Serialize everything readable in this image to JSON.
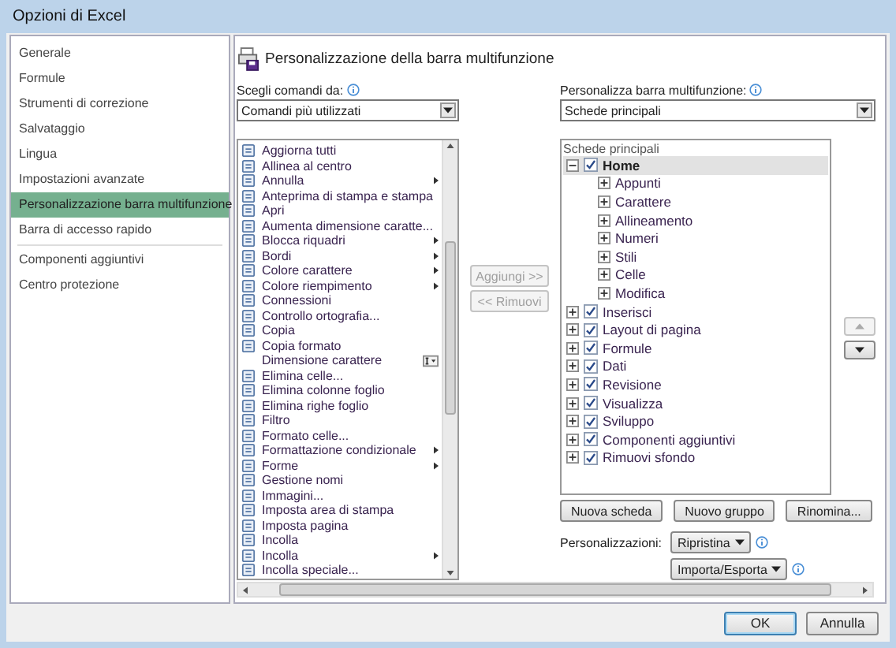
{
  "window": {
    "title": "Opzioni di Excel"
  },
  "sidebar": {
    "groups": [
      {
        "items": [
          {
            "label": "Generale",
            "selected": false
          },
          {
            "label": "Formule",
            "selected": false
          },
          {
            "label": "Strumenti di correzione",
            "selected": false
          },
          {
            "label": "Salvataggio",
            "selected": false
          },
          {
            "label": "Lingua",
            "selected": false
          },
          {
            "label": "Impostazioni avanzate",
            "selected": false
          },
          {
            "label": "Personalizzazione barra multifunzione",
            "selected": true
          },
          {
            "label": "Barra di accesso rapido",
            "selected": false
          }
        ]
      },
      {
        "items": [
          {
            "label": "Componenti aggiuntivi",
            "selected": false
          },
          {
            "label": "Centro protezione",
            "selected": false
          }
        ]
      }
    ]
  },
  "page": {
    "title": "Personalizzazione della barra multifunzione"
  },
  "commands": {
    "label": "Scegli comandi da:",
    "dropdown": "Comandi più utilizzati",
    "items": [
      {
        "label": "Aggiorna tutti",
        "kind": "plain"
      },
      {
        "label": "Allinea al centro",
        "kind": "plain"
      },
      {
        "label": "Annulla",
        "kind": "submenu"
      },
      {
        "label": "Anteprima di stampa e stampa",
        "kind": "plain"
      },
      {
        "label": "Apri",
        "kind": "plain"
      },
      {
        "label": "Aumenta dimensione caratte...",
        "kind": "plain"
      },
      {
        "label": "Blocca riquadri",
        "kind": "submenu"
      },
      {
        "label": "Bordi",
        "kind": "submenu"
      },
      {
        "label": "Colore carattere",
        "kind": "submenu"
      },
      {
        "label": "Colore riempimento",
        "kind": "submenu"
      },
      {
        "label": "Connessioni",
        "kind": "plain"
      },
      {
        "label": "Controllo ortografia...",
        "kind": "plain"
      },
      {
        "label": "Copia",
        "kind": "plain"
      },
      {
        "label": "Copia formato",
        "kind": "plain"
      },
      {
        "label": "Dimensione carattere",
        "kind": "combo"
      },
      {
        "label": "Elimina celle...",
        "kind": "plain"
      },
      {
        "label": "Elimina colonne foglio",
        "kind": "plain"
      },
      {
        "label": "Elimina righe foglio",
        "kind": "plain"
      },
      {
        "label": "Filtro",
        "kind": "plain"
      },
      {
        "label": "Formato celle...",
        "kind": "plain"
      },
      {
        "label": "Formattazione condizionale",
        "kind": "submenu"
      },
      {
        "label": "Forme",
        "kind": "submenu"
      },
      {
        "label": "Gestione nomi",
        "kind": "plain"
      },
      {
        "label": "Immagini...",
        "kind": "plain"
      },
      {
        "label": "Imposta area di stampa",
        "kind": "plain"
      },
      {
        "label": "Imposta pagina",
        "kind": "plain"
      },
      {
        "label": "Incolla",
        "kind": "plain"
      },
      {
        "label": "Incolla",
        "kind": "submenu"
      },
      {
        "label": "Incolla speciale...",
        "kind": "plain"
      }
    ]
  },
  "transfer_buttons": [
    {
      "label": "Aggiungi >>",
      "disabled": true
    },
    {
      "label": "<< Rimuovi",
      "disabled": true
    }
  ],
  "ribbon": {
    "label": "Personalizza barra multifunzione:",
    "dropdown": "Schede principali",
    "tree_header": "Schede principali",
    "tabs": [
      {
        "label": "Home",
        "checked": true,
        "expanded": true,
        "selected": true,
        "children": [
          {
            "label": "Appunti",
            "expanded": false
          },
          {
            "label": "Carattere",
            "expanded": false
          },
          {
            "label": "Allineamento",
            "expanded": false
          },
          {
            "label": "Numeri",
            "expanded": false
          },
          {
            "label": "Stili",
            "expanded": false
          },
          {
            "label": "Celle",
            "expanded": false
          },
          {
            "label": "Modifica",
            "expanded": false
          }
        ]
      },
      {
        "label": "Inserisci",
        "checked": true,
        "expanded": false,
        "selected": false
      },
      {
        "label": "Layout di pagina",
        "checked": true,
        "expanded": false,
        "selected": false
      },
      {
        "label": "Formule",
        "checked": true,
        "expanded": false,
        "selected": false
      },
      {
        "label": "Dati",
        "checked": true,
        "expanded": false,
        "selected": false
      },
      {
        "label": "Revisione",
        "checked": true,
        "expanded": false,
        "selected": false
      },
      {
        "label": "Visualizza",
        "checked": true,
        "expanded": false,
        "selected": false
      },
      {
        "label": "Sviluppo",
        "checked": true,
        "expanded": false,
        "selected": false
      },
      {
        "label": "Componenti aggiuntivi",
        "checked": true,
        "expanded": false,
        "selected": false
      },
      {
        "label": "Rimuovi sfondo",
        "checked": true,
        "expanded": false,
        "selected": false
      }
    ]
  },
  "move_buttons": [
    {
      "kind": "up",
      "disabled": true
    },
    {
      "kind": "down",
      "disabled": false
    }
  ],
  "tree_buttons": [
    "Nuova scheda",
    "Nuovo gruppo",
    "Rinomina..."
  ],
  "customizations": {
    "label": "Personalizzazioni:",
    "buttons": [
      "Ripristina",
      "Importa/Esporta"
    ]
  },
  "dialog_buttons": [
    {
      "label": "OK",
      "default": true
    },
    {
      "label": "Annulla",
      "default": false
    }
  ]
}
